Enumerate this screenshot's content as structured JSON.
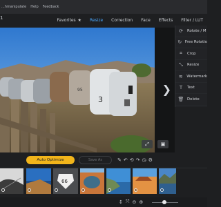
{
  "menubar": {
    "items": [
      "...hmanipulate",
      "Help",
      "Feedback"
    ]
  },
  "app_number": "1",
  "nav": {
    "favorites": "Favorites",
    "favorites_icon": "star-icon",
    "resize": "Resize",
    "correction": "Correction",
    "face": "Face",
    "effects": "Effects",
    "filter_lut": "Filter / LUT"
  },
  "canvas": {
    "next_icon": "chevron-right-icon",
    "fit_icon": "expand-icon",
    "compare_icon": "compare-icon"
  },
  "right_panel": {
    "items": [
      {
        "icon": "rotate-icon",
        "label": "Rotate / M"
      },
      {
        "icon": "free-rotate-icon",
        "label": "Free Rotatio"
      },
      {
        "icon": "crop-icon",
        "label": "Crop"
      },
      {
        "icon": "resize-icon",
        "label": "Resize"
      },
      {
        "icon": "watermark-icon",
        "label": "Watermark"
      },
      {
        "icon": "text-icon",
        "label": "Text"
      },
      {
        "icon": "delete-icon",
        "label": "Delete"
      }
    ]
  },
  "toolbar": {
    "auto_optimize": "Auto Optimize",
    "save_as": "Save As",
    "icons": [
      "brush-icon",
      "undo-icon",
      "undo-all-icon",
      "redo-icon",
      "history-icon",
      "settings-icon"
    ]
  },
  "filmstrip": {
    "thumbs": [
      "marble-wall",
      "coastline",
      "route-66-sign",
      "canyon-river",
      "ocean-cliffs",
      "desert-mesa",
      "lake-mountains"
    ]
  },
  "status": {
    "icons": [
      "swap-icon",
      "fit-icon",
      "zoom-out-icon",
      "zoom-in-icon"
    ],
    "zoom_level": 0.4
  },
  "colors": {
    "accent": "#4aa8ff",
    "auto_button": "#f2b51b",
    "background": "#1e1f21"
  }
}
